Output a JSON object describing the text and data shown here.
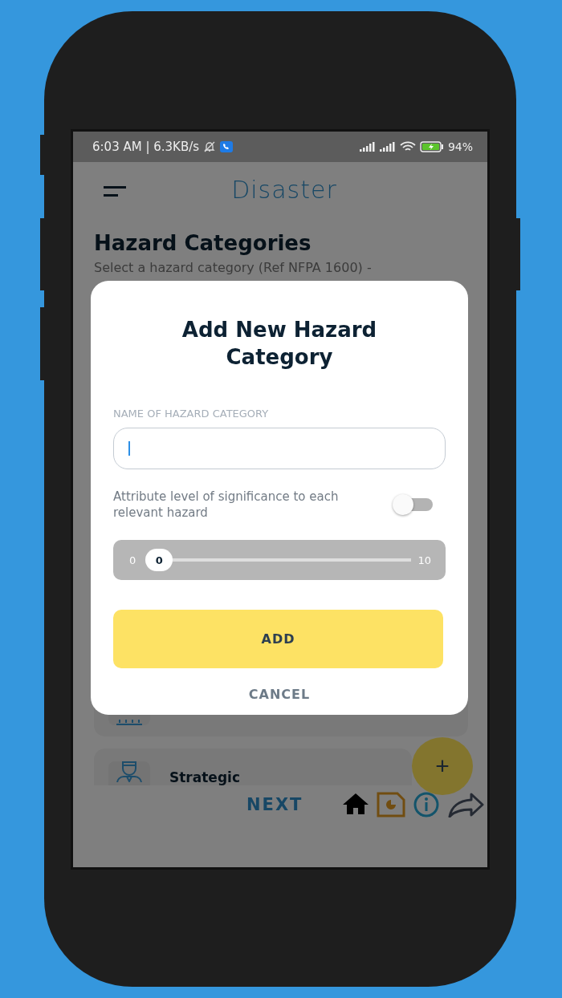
{
  "status_bar": {
    "time": "6:03 AM | 6.3KB/s",
    "battery": "94%"
  },
  "header": {
    "title": "Disaster"
  },
  "page": {
    "title": "Hazard Categories",
    "description": "Select a hazard category (Ref NFPA 1600) -"
  },
  "categories": [
    {
      "kind": "chart"
    },
    {
      "kind": "person",
      "label": "Strategic"
    }
  ],
  "fab": {
    "label": "+"
  },
  "bottom_bar": {
    "next": "NEXT"
  },
  "dialog": {
    "title": "Add New Hazard Category",
    "field_label": "NAME OF HAZARD CATEGORY",
    "toggle_label": "Attribute level of significance to each relevant hazard",
    "toggle": {
      "on": false
    },
    "slider": {
      "min": "0",
      "max": "10",
      "reading": "0",
      "level": 0
    },
    "add": "ADD",
    "cancel": "CANCEL"
  }
}
